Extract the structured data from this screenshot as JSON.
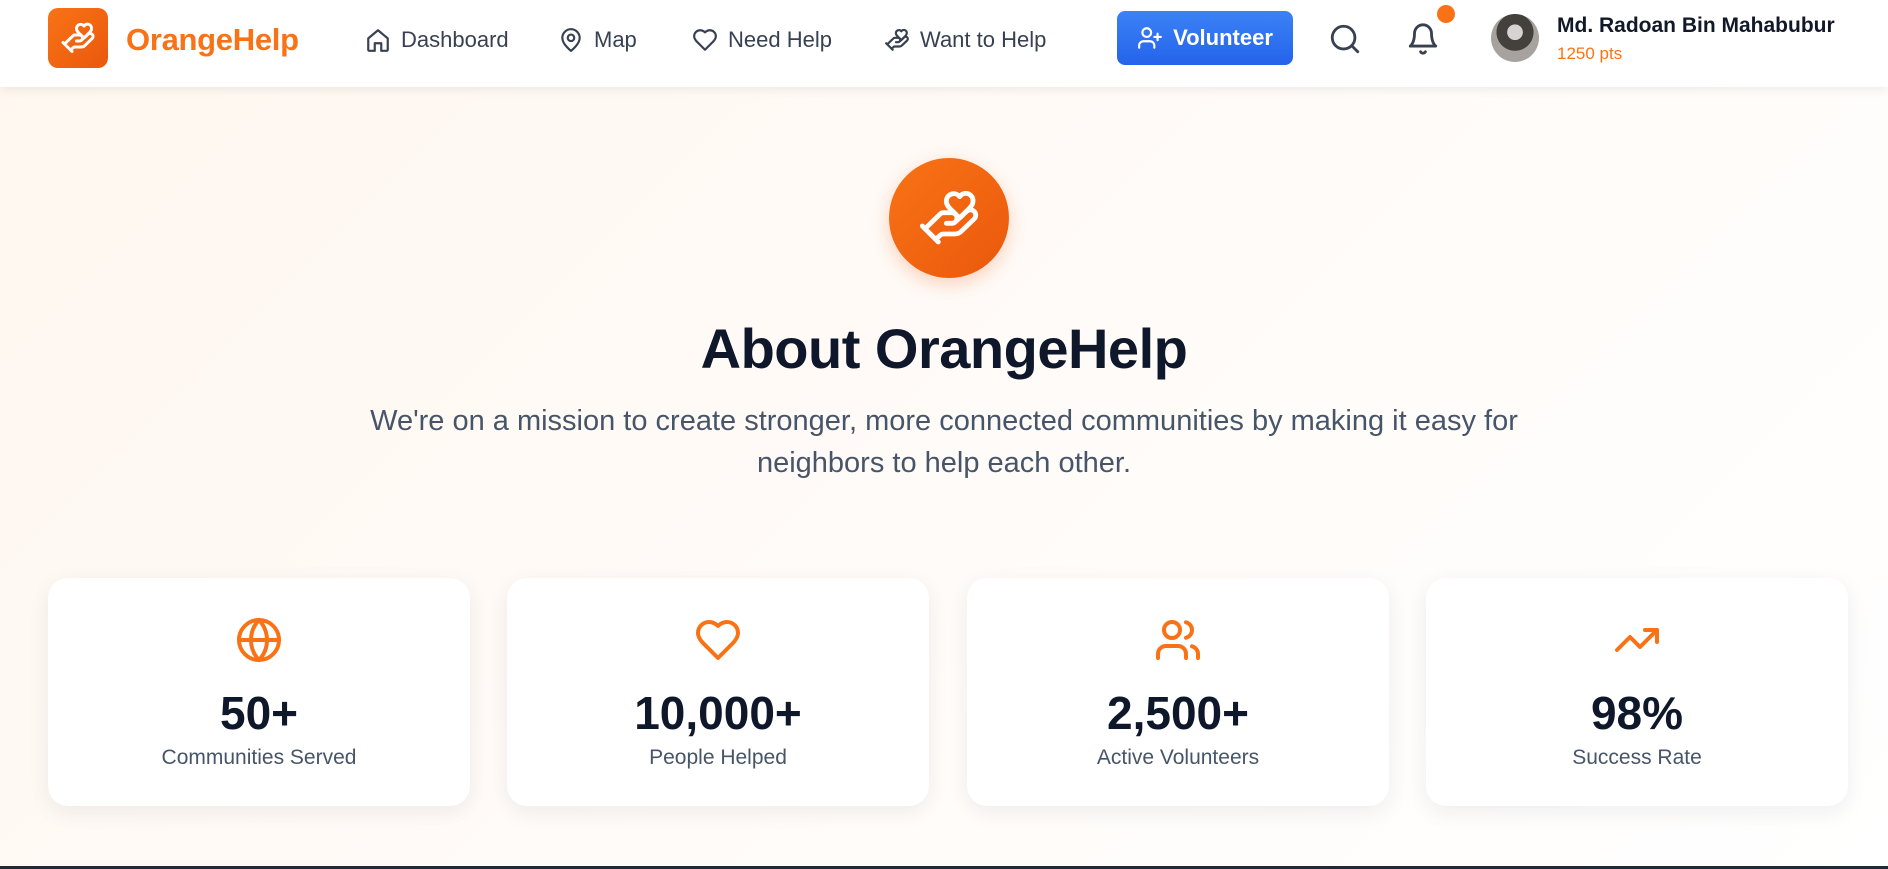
{
  "nav": {
    "brand": "OrangeHelp",
    "links": [
      {
        "label": "Dashboard",
        "icon": "home-icon"
      },
      {
        "label": "Map",
        "icon": "map-pin-icon"
      },
      {
        "label": "Need Help",
        "icon": "heart-icon"
      },
      {
        "label": "Want to Help",
        "icon": "hand-heart-icon"
      }
    ],
    "volunteer_label": "Volunteer",
    "user": {
      "name": "Md. Radoan Bin Mahabubur",
      "points": "1250 pts"
    }
  },
  "hero": {
    "title": "About OrangeHelp",
    "subtitle": "We're on a mission to create stronger, more connected communities by making it easy for neighbors to help each other."
  },
  "stats": [
    {
      "value": "50+",
      "label": "Communities Served",
      "icon": "globe-icon"
    },
    {
      "value": "10,000+",
      "label": "People Helped",
      "icon": "heart-icon"
    },
    {
      "value": "2,500+",
      "label": "Active Volunteers",
      "icon": "users-icon"
    },
    {
      "value": "98%",
      "label": "Success Rate",
      "icon": "trending-up-icon"
    }
  ],
  "colors": {
    "brand": "#f97316",
    "accent_blue": "#2563eb",
    "text": "#0f172a"
  }
}
